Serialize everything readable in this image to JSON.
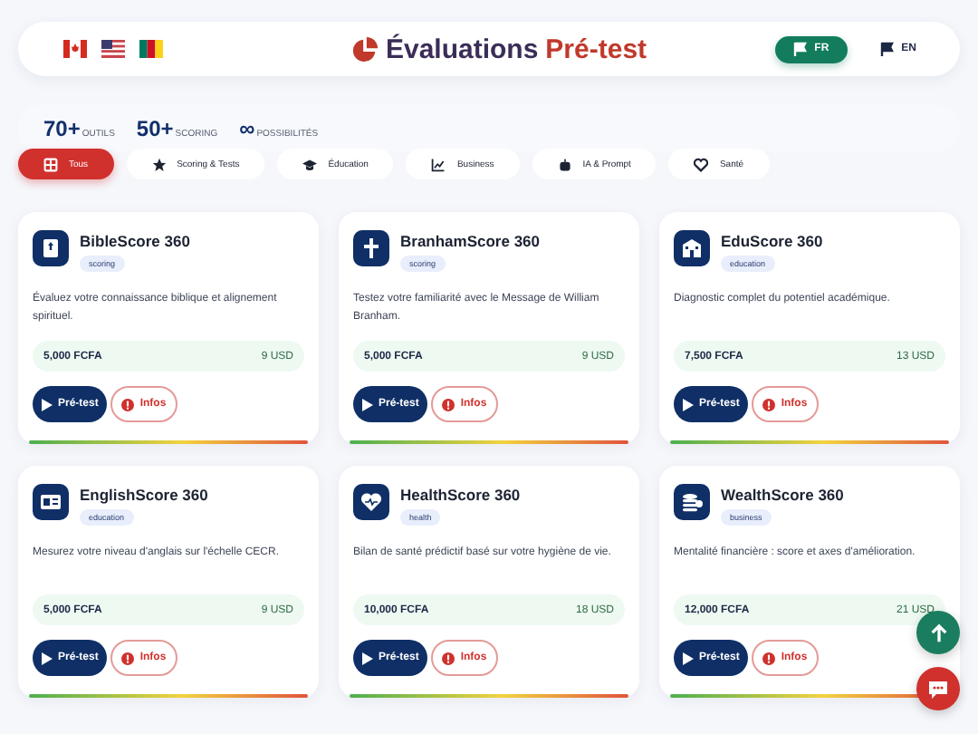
{
  "header": {
    "title_main": "Évaluations",
    "title_accent": "Pré-test",
    "languages": [
      {
        "label": "FR",
        "selected": true
      },
      {
        "label": "EN",
        "selected": false
      }
    ]
  },
  "stats": [
    {
      "value": "70+",
      "label": "OUTILS"
    },
    {
      "value": "50+",
      "label": "SCORING"
    },
    {
      "value": "∞",
      "label": "POSSIBILITÉS"
    }
  ],
  "filters": [
    {
      "label": "Tous",
      "selected": true
    },
    {
      "label": "Scoring & Tests",
      "selected": false
    },
    {
      "label": "Éducation",
      "selected": false
    },
    {
      "label": "Business",
      "selected": false
    },
    {
      "label": "IA & Prompt",
      "selected": false
    },
    {
      "label": "Santé",
      "selected": false
    }
  ],
  "cards": [
    {
      "title": "BibleScore 360",
      "tag": "scoring",
      "description": "Évaluez votre connaissance biblique et alignement spirituel.",
      "price_fcfa": "5,000 FCFA",
      "price_usd": "9 USD",
      "primary": "Pré-test",
      "secondary": "Infos"
    },
    {
      "title": "BranhamScore 360",
      "tag": "scoring",
      "description": "Testez votre familiarité avec le Message de William Branham.",
      "price_fcfa": "5,000 FCFA",
      "price_usd": "9 USD",
      "primary": "Pré-test",
      "secondary": "Infos"
    },
    {
      "title": "EduScore 360",
      "tag": "education",
      "description": "Diagnostic complet du potentiel académique.",
      "price_fcfa": "7,500 FCFA",
      "price_usd": "13 USD",
      "primary": "Pré-test",
      "secondary": "Infos"
    },
    {
      "title": "EnglishScore 360",
      "tag": "education",
      "description": "Mesurez votre niveau d'anglais sur l'échelle CECR.",
      "price_fcfa": "5,000 FCFA",
      "price_usd": "9 USD",
      "primary": "Pré-test",
      "secondary": "Infos"
    },
    {
      "title": "HealthScore 360",
      "tag": "health",
      "description": "Bilan de santé prédictif basé sur votre hygiène de vie.",
      "price_fcfa": "10,000 FCFA",
      "price_usd": "18 USD",
      "primary": "Pré-test",
      "secondary": "Infos"
    },
    {
      "title": "WealthScore 360",
      "tag": "business",
      "description": "Mentalité financière : score et axes d'amélioration.",
      "price_fcfa": "12,000 FCFA",
      "price_usd": "21 USD",
      "primary": "Pré-test",
      "secondary": "Infos"
    }
  ]
}
